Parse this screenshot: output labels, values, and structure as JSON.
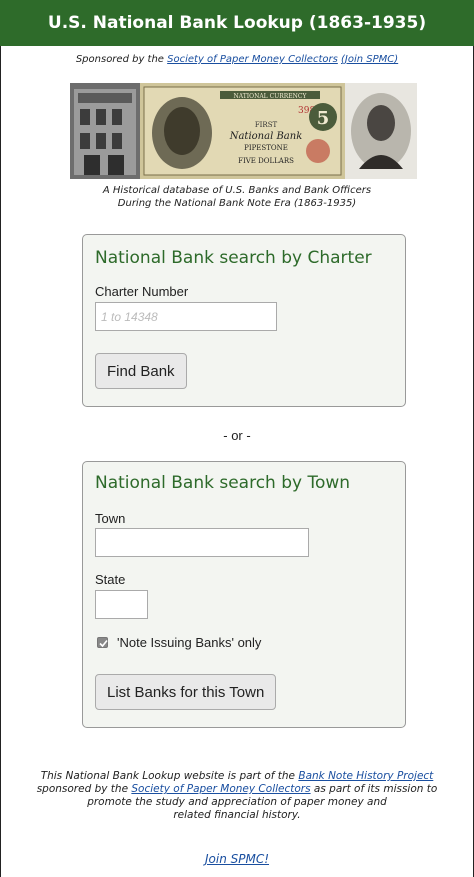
{
  "header": {
    "title": "U.S. National Bank Lookup (1863-1935)"
  },
  "sponsor": {
    "prefix": "Sponsored by the ",
    "spmc_link": "Society of Paper Money Collectors",
    "join_link": "(Join SPMC)"
  },
  "banner": {
    "note_lines": [
      "NATIONAL CURRENCY",
      "3982",
      "FIRST",
      "National Bank",
      "PIPESTONE",
      "FIVE DOLLARS"
    ],
    "denomination": "5"
  },
  "tagline": {
    "line1": "A Historical database of U.S. Banks and Bank Officers",
    "line2": "During the National Bank Note Era (1863-1935)"
  },
  "charter_search": {
    "title": "National Bank search by Charter",
    "field_label": "Charter Number",
    "placeholder": "1 to 14348",
    "value": "",
    "button_label": "Find Bank"
  },
  "divider": "- or -",
  "town_search": {
    "title": "National Bank search by Town",
    "town_label": "Town",
    "town_value": "",
    "state_label": "State",
    "state_value": "",
    "checkbox_label": "'Note Issuing Banks' only",
    "checkbox_checked": true,
    "button_label": "List Banks for this Town"
  },
  "footer": {
    "line1_prefix": "This National Bank Lookup website is part of the ",
    "project_link": "Bank Note History Project",
    "line2_prefix": "sponsored by the ",
    "spmc_link": "Society of Paper Money Collectors",
    "line2_suffix": " as part of its mission to",
    "line3": "promote the study and appreciation of paper money and",
    "line4": "related financial history.",
    "join_link": "Join SPMC!"
  },
  "colors": {
    "header_bg": "#2e6b2a",
    "panel_title": "#2d6a2a",
    "link": "#1a4fa0",
    "panel_bg": "#f3f5f1"
  }
}
